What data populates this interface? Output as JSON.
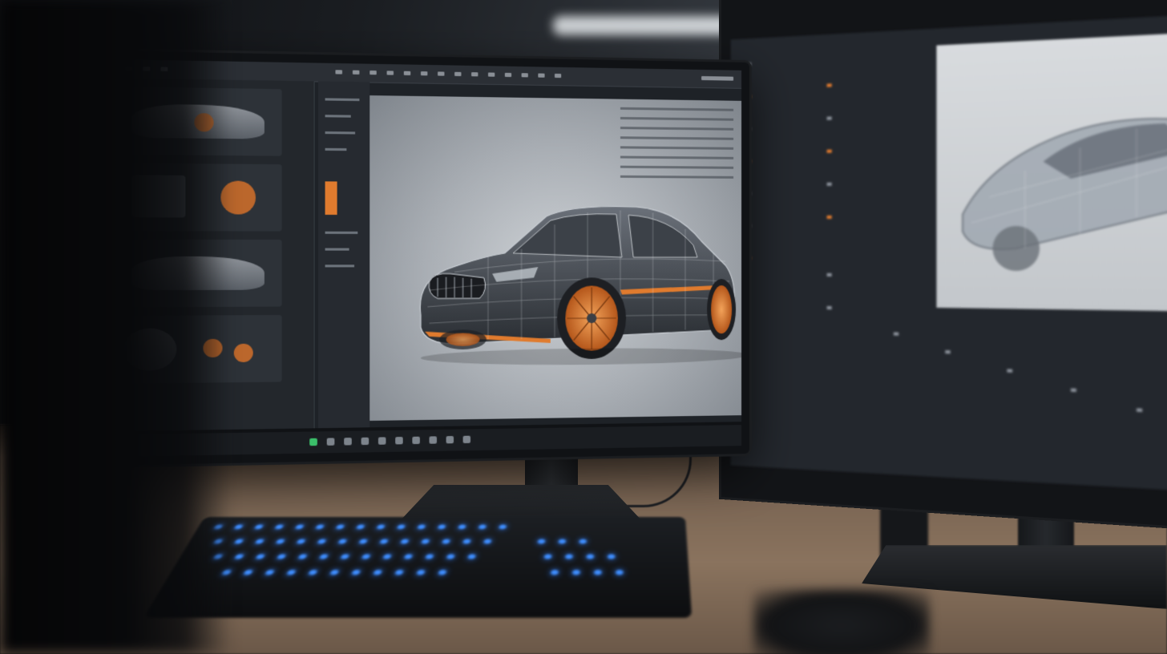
{
  "scene": {
    "description_icon": "photo-of-desk",
    "accent_color": "#e07b2e",
    "keyboard_backlight_color": "#3f8eff"
  },
  "left_monitor": {
    "app": "3d-modeling-software",
    "viewport_subject_icon": "car-wireframe-icon"
  },
  "right_monitor": {
    "app": "3d-modeling-software",
    "preview_subject_icon": "car-preview-icon"
  }
}
